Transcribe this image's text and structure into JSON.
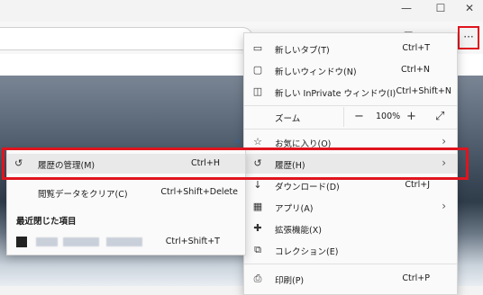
{
  "window_controls": {
    "minimize": "—",
    "maximize": "☐",
    "close": "✕"
  },
  "more_button": "···",
  "menu": {
    "items": [
      {
        "label": "新しいタブ(T)",
        "shortcut": "Ctrl+T",
        "icon": "new-tab-icon"
      },
      {
        "label": "新しいウィンドウ(N)",
        "shortcut": "Ctrl+N",
        "icon": "new-window-icon"
      },
      {
        "label": "新しい InPrivate ウィンドウ(I)",
        "shortcut": "Ctrl+Shift+N",
        "icon": "inprivate-icon"
      }
    ],
    "zoom": {
      "label": "ズーム",
      "minus": "−",
      "value": "100%",
      "plus": "+",
      "fullscreen": "⤢"
    },
    "favorites": {
      "label": "お気に入り(O)",
      "arrow": "›"
    },
    "history": {
      "label": "履歴(H)",
      "arrow": "›"
    },
    "downloads": {
      "label": "ダウンロード(D)",
      "shortcut": "Ctrl+J"
    },
    "apps": {
      "label": "アプリ(A)",
      "arrow": "›"
    },
    "extensions": {
      "label": "拡張機能(X)"
    },
    "collections": {
      "label": "コレクション(E)"
    },
    "print": {
      "label": "印刷(P)",
      "shortcut": "Ctrl+P"
    }
  },
  "history_submenu": {
    "manage": {
      "label": "履歴の管理(M)",
      "shortcut": "Ctrl+H"
    },
    "clear": {
      "label": "閲覧データをクリア(C)",
      "shortcut": "Ctrl+Shift+Delete"
    },
    "recent_header": "最近閉じた項目",
    "recent_shortcut": "Ctrl+Shift+T"
  },
  "colors": {
    "highlight": "#e0141e",
    "menu_bg": "#fafafa"
  }
}
